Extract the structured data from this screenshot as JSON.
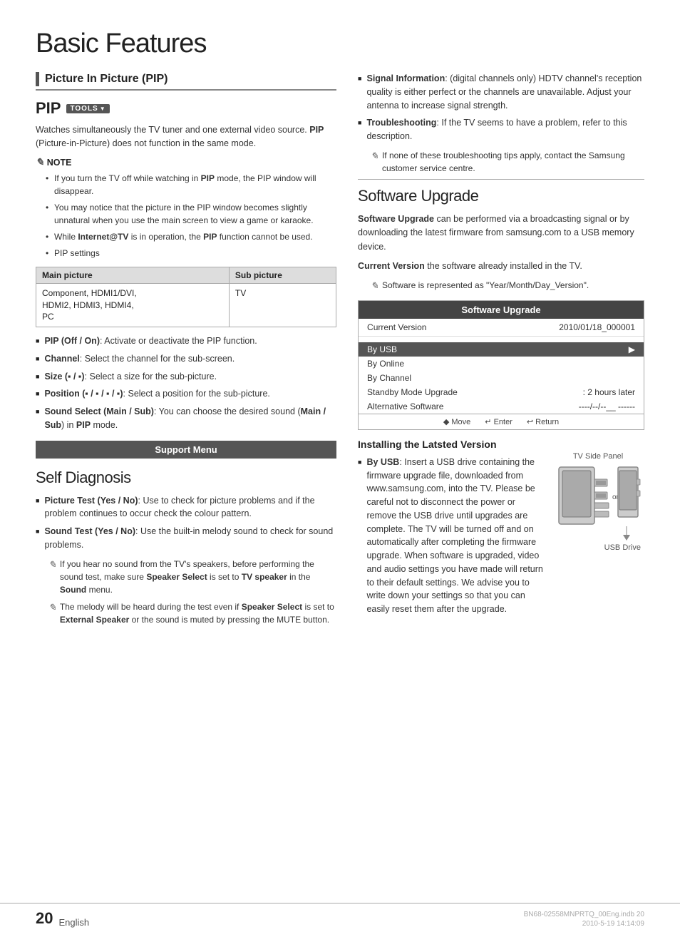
{
  "page": {
    "title": "Basic Features",
    "number": "20",
    "language": "English",
    "footer_file": "BN68-02558MNPRTQ_00Eng.indb   20",
    "footer_date": "2010-5-19   14:14:09"
  },
  "left_column": {
    "section_title": "Picture In Picture (PIP)",
    "pip": {
      "heading": "PIP",
      "tools_label": "TOOLS",
      "description": "Watches simultaneously the TV tuner and one external video source. PIP (Picture-in-Picture) does not function in the same mode.",
      "note_label": "NOTE",
      "notes": [
        "If you turn the TV off while watching in PIP mode, the PIP window will disappear.",
        "You may notice that the picture in the PIP window becomes slightly unnatural when you use the main screen to view a game or karaoke.",
        "While Internet@TV is in operation, the PIP function cannot be used.",
        "PIP settings"
      ],
      "table": {
        "headers": [
          "Main picture",
          "Sub picture"
        ],
        "rows": [
          [
            "Component, HDMI1/DVI, HDMI2, HDMI3, HDMI4, PC",
            "TV"
          ]
        ]
      }
    },
    "bullet_items": [
      {
        "label": "PIP (Off / On)",
        "text": ": Activate or deactivate the PIP function."
      },
      {
        "label": "Channel",
        "text": ": Select the channel for the sub-screen."
      },
      {
        "label": "Size (▪ / ▪)",
        "text": ": Select a size for the sub-picture."
      },
      {
        "label": "Position (▪ / ▪ / ▪ / ▪)",
        "text": ": Select a position for the sub-picture."
      },
      {
        "label": "Sound Select (Main / Sub)",
        "text": ": You can choose the desired sound (Main / Sub) in PIP mode."
      }
    ],
    "support_menu": "Support Menu",
    "self_diagnosis": {
      "heading": "Self Diagnosis",
      "items": [
        {
          "label": "Picture Test (Yes / No)",
          "text": ": Use to check for picture problems and if the problem continues to occur check the colour pattern."
        },
        {
          "label": "Sound Test (Yes / No)",
          "text": ": Use the built-in melody sound to check for sound problems."
        }
      ],
      "sound_notes": [
        "If you hear no sound from the TV's speakers, before performing the sound test, make sure Speaker Select is set to TV speaker in the Sound menu.",
        "The melody will be heard during the test even if Speaker Select is set to External Speaker or the sound is muted by pressing the MUTE button."
      ]
    }
  },
  "right_column": {
    "signal_information": {
      "label": "Signal Information",
      "text": ": (digital channels only) HDTV channel's reception quality is either perfect or the channels are unavailable. Adjust your antenna to increase signal strength."
    },
    "troubleshooting": {
      "label": "Troubleshooting",
      "text": ": If the TV seems to have a problem, refer to this description."
    },
    "troubleshooting_note": "If none of these troubleshooting tips apply, contact the Samsung customer service centre.",
    "software_upgrade": {
      "heading": "Software Upgrade",
      "description": "Software Upgrade can be performed via a broadcasting signal or by downloading the latest firmware from samsung.com to a USB memory device.",
      "current_version_label": "Current Version",
      "current_version_text": "the software already installed in the TV.",
      "software_note": "Software is represented as \"Year/Month/Day_Version\".",
      "box": {
        "title": "Software Upgrade",
        "current_version_label": "Current Version",
        "current_version_value": "2010/01/18_000001",
        "menu_items": [
          {
            "label": "By USB",
            "active": true,
            "arrow": true
          },
          {
            "label": "By Online",
            "active": false
          },
          {
            "label": "By Channel",
            "active": false
          },
          {
            "label": "Standby Mode Upgrade",
            "value": ": 2 hours later",
            "active": false
          },
          {
            "label": "Alternative Software",
            "value": "----/--/--__ ------",
            "active": false
          }
        ],
        "footer_move": "◆ Move",
        "footer_enter": "↵ Enter",
        "footer_return": "↩ Return"
      },
      "installing_header": "Installing the Latsted Version",
      "by_usb_label": "By USB",
      "by_usb_text": ": Insert a USB drive containing the firmware upgrade file, downloaded from www.samsung.com, into the TV. Please be careful not to disconnect the power or remove the USB drive until upgrades are complete. The TV will be turned off and on automatically after completing the firmware upgrade. When software is upgraded, video and audio settings you have made will return to their default settings. We advise you to write down your settings so that you can easily reset them after the upgrade.",
      "tv_side_panel_label": "TV Side Panel",
      "or_label": "or",
      "usb_drive_label": "USB Drive"
    }
  }
}
